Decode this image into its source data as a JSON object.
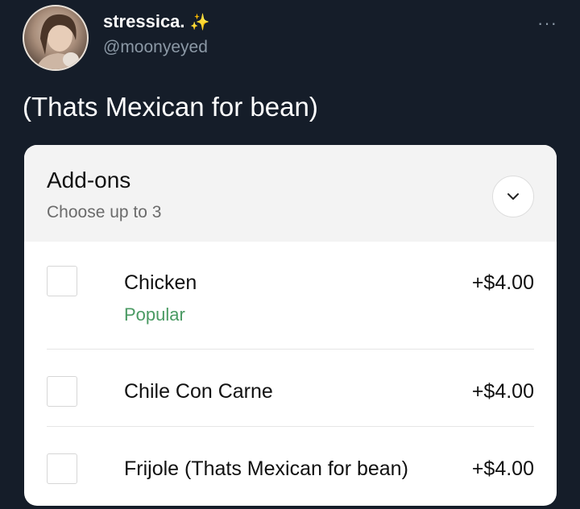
{
  "tweet": {
    "display_name": "stressica.",
    "sparkles_icon": "sparkles-icon",
    "handle": "@moonyeyed",
    "more_label": "···",
    "text": "(Thats Mexican for bean)"
  },
  "card": {
    "title": "Add-ons",
    "subtitle": "Choose up to 3",
    "collapse_icon": "chevron-down-icon",
    "options": [
      {
        "label": "Chicken",
        "badge": "Popular",
        "price": "+$4.00"
      },
      {
        "label": "Chile Con Carne",
        "price": "+$4.00"
      },
      {
        "label": "Frijole (Thats Mexican for bean)",
        "price": "+$4.00"
      }
    ]
  },
  "colors": {
    "background": "#151d29",
    "popular_green": "#4a9a63",
    "handle_gray": "#8b98a5"
  }
}
